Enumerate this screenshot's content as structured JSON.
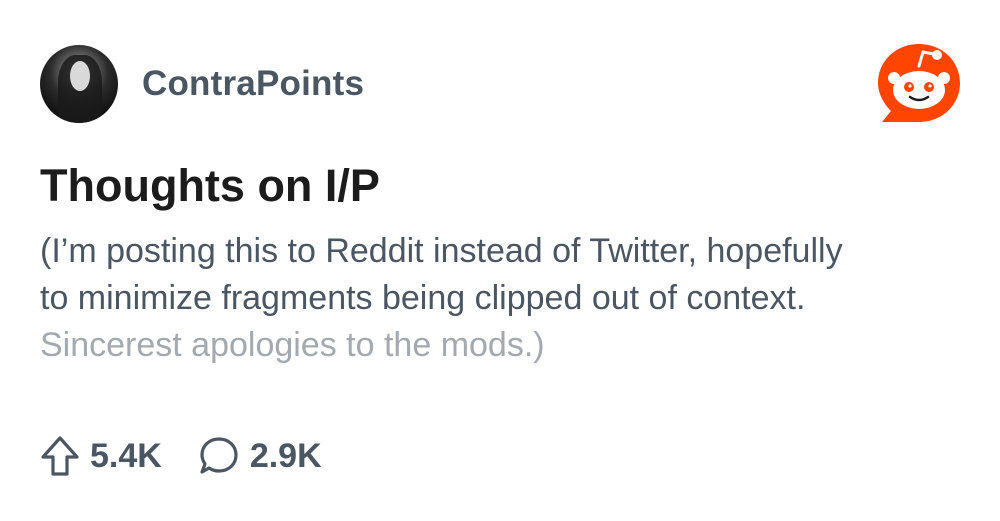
{
  "post": {
    "author": "ContraPoints",
    "title": "Thoughts on I/P",
    "body_lines": [
      "(I’m posting this to Reddit instead of Twitter, hopefully",
      "to minimize fragments being clipped out of context.",
      "Sincerest apologies to the mods.)"
    ]
  },
  "stats": {
    "upvotes": "5.4K",
    "comments": "2.9K"
  },
  "icons": {
    "avatar": "author-avatar",
    "logo": "reddit-snoo-icon",
    "upvote": "upvote-arrow-icon",
    "comment": "comment-bubble-icon"
  },
  "colors": {
    "brand": "#ff4500",
    "text_primary": "#1c1c1c",
    "text_secondary": "#4a5661",
    "text_faded": "#a3a9ae"
  }
}
